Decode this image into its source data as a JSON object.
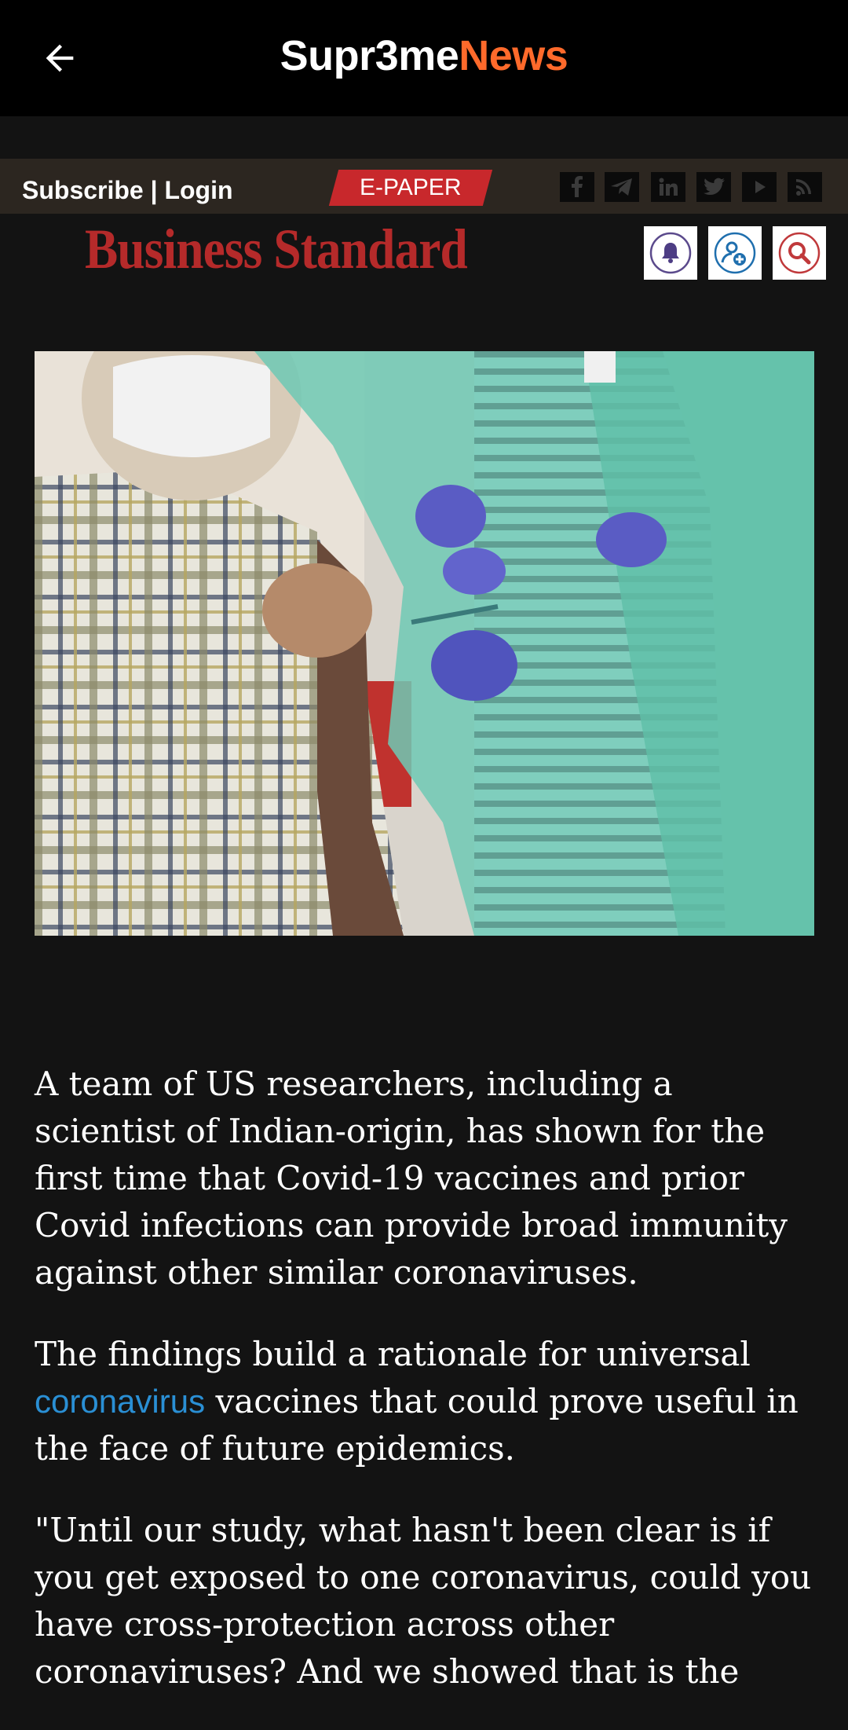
{
  "appbar": {
    "brand_part1": "Supr3me",
    "brand_part2": "News",
    "back_icon": "arrow-left-icon"
  },
  "site_header": {
    "subscribe_login": "Subscribe | Login",
    "epaper_label": "E-PAPER",
    "social_icons": [
      "facebook-icon",
      "telegram-icon",
      "linkedin-icon",
      "twitter-icon",
      "youtube-icon",
      "rss-icon"
    ],
    "logo_text": "Business Standard",
    "logo_color": "#b52a2a",
    "tools": [
      "bell-icon",
      "add-user-icon",
      "search-icon"
    ]
  },
  "article": {
    "image_alt": "Elderly man in plaid shirt receiving a vaccine injection from health workers in teal gowns",
    "p1": "A team of US researchers, including a scientist of Indian-origin, has shown for the first time that Covid-19 vaccines and prior Covid infections can provide broad immunity against other similar coronaviruses.",
    "p2_before": "The findings build a rationale for universal ",
    "p2_link": "coronavirus",
    "p2_after": " vaccines that could prove useful in the face of future epidemics.",
    "p3": "\"Until our study, what hasn't been clear is if you get exposed to one coronavirus, could you have cross-protection across other coronaviruses? And we showed that is the",
    "link_color": "#2a8fd4"
  },
  "colors": {
    "brand_accent": "#ff6a2b",
    "epaper_bg": "#c8282c",
    "sitebar_bg": "#2c2620"
  }
}
